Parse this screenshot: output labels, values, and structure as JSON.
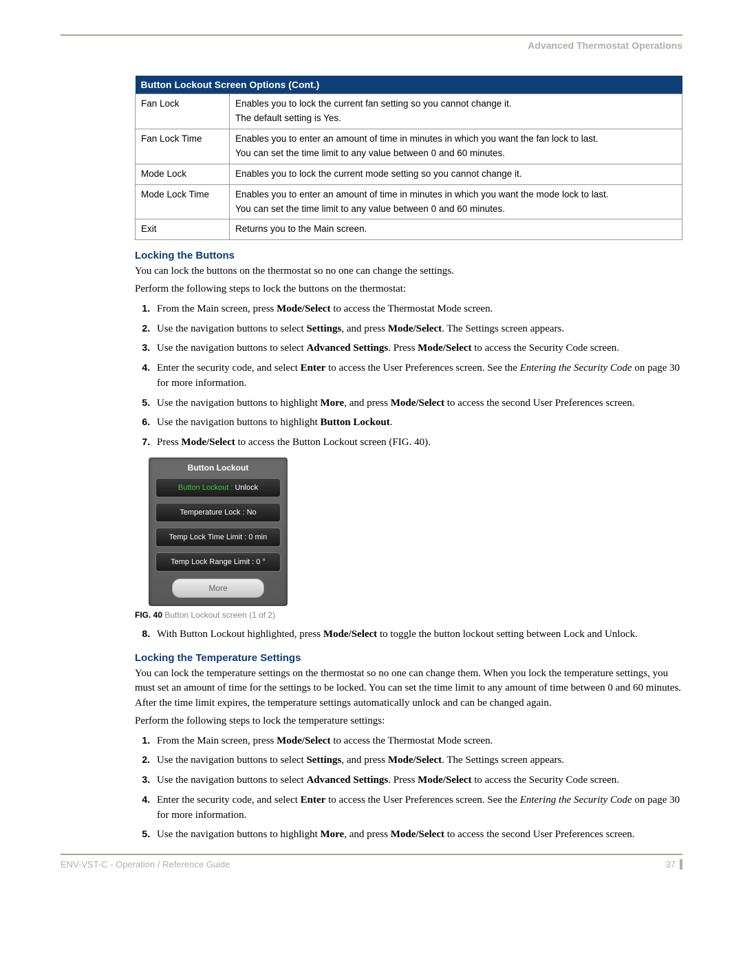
{
  "header": {
    "section_label": "Advanced Thermostat Operations"
  },
  "table": {
    "title": "Button Lockout Screen Options (Cont.)",
    "rows": [
      {
        "name": "Fan Lock",
        "desc": "Enables you to lock the current fan setting so you cannot change it.\nThe default setting is Yes."
      },
      {
        "name": "Fan Lock Time",
        "desc": "Enables you to enter an amount of time in minutes in which you want the fan lock to last.\nYou can set the time limit to any value between 0 and 60 minutes."
      },
      {
        "name": "Mode Lock",
        "desc": "Enables you to lock the current mode setting so you cannot change it."
      },
      {
        "name": "Mode Lock Time",
        "desc": "Enables you to enter an amount of time in minutes in which you want the mode lock to last.\nYou can set the time limit to any value between 0 and 60 minutes."
      },
      {
        "name": "Exit",
        "desc": "Returns you to the Main screen."
      }
    ]
  },
  "section1": {
    "heading": "Locking the Buttons",
    "intro1": "You can lock the buttons on the thermostat so no one can change the settings.",
    "intro2": "Perform the following steps to lock the buttons on the thermostat:",
    "steps": {
      "s1a": "From the Main screen, press ",
      "s1b": "Mode/Select",
      "s1c": " to access the Thermostat Mode screen.",
      "s2a": "Use the navigation buttons to select ",
      "s2b": "Settings",
      "s2c": ", and press ",
      "s2d": "Mode/Select",
      "s2e": ". The Settings screen appears.",
      "s3a": "Use the navigation buttons to select ",
      "s3b": "Advanced Settings",
      "s3c": ". Press ",
      "s3d": "Mode/Select",
      "s3e": " to access the Security Code screen.",
      "s4a": "Enter the security code, and select ",
      "s4b": "Enter",
      "s4c": " to access the User Preferences screen. See the ",
      "s4d": "Entering the Security Code",
      "s4e": " on page 30 for more information.",
      "s5a": "Use the navigation buttons to highlight ",
      "s5b": "More",
      "s5c": ", and press ",
      "s5d": "Mode/Select",
      "s5e": " to access the second User Preferences screen.",
      "s6a": "Use the navigation buttons to highlight ",
      "s6b": "Button Lockout",
      "s6c": ".",
      "s7a": "Press ",
      "s7b": "Mode/Select",
      "s7c": " to access the Button Lockout screen (FIG. 40).",
      "s8a": "With Button Lockout highlighted, press ",
      "s8b": "Mode/Select",
      "s8c": " to toggle the button lockout setting between Lock and Unlock."
    }
  },
  "figure": {
    "title": "Button Lockout",
    "r1_label": "Button Lockout :",
    "r1_value": "Unlock",
    "r2": "Temperature Lock : No",
    "r3": "Temp Lock Time Limit : 0 min",
    "r4": "Temp Lock Range Limit : 0 °",
    "more": "More",
    "caption_no": "FIG. 40",
    "caption_text": "  Button Lockout screen (1 of 2)"
  },
  "section2": {
    "heading": "Locking the Temperature Settings",
    "intro1": "You can lock the temperature settings on the thermostat so no one can change them. When you lock the temperature settings, you must set an amount of time for the settings to be locked. You can set the time limit to any amount of time between 0 and 60 minutes. After the time limit expires, the temperature settings automatically unlock and can be changed again.",
    "intro2": "Perform the following steps to lock the temperature settings:",
    "steps": {
      "s1a": "From the Main screen, press ",
      "s1b": "Mode/Select",
      "s1c": " to access the Thermostat Mode screen.",
      "s2a": "Use the navigation buttons to select ",
      "s2b": "Settings",
      "s2c": ", and press ",
      "s2d": "Mode/Select",
      "s2e": ". The Settings screen appears.",
      "s3a": "Use the navigation buttons to select ",
      "s3b": "Advanced Settings",
      "s3c": ". Press ",
      "s3d": "Mode/Select",
      "s3e": " to access the Security Code screen.",
      "s4a": "Enter the security code, and select ",
      "s4b": "Enter",
      "s4c": " to access the User Preferences screen. See the ",
      "s4d": "Entering the Security Code",
      "s4e": " on page 30 for more information.",
      "s5a": "Use the navigation buttons to highlight ",
      "s5b": "More",
      "s5c": ", and press ",
      "s5d": "Mode/Select",
      "s5e": " to access the second User Preferences screen."
    }
  },
  "footer": {
    "left": "ENV-VST-C - Operation / Reference Guide",
    "page": "37"
  }
}
